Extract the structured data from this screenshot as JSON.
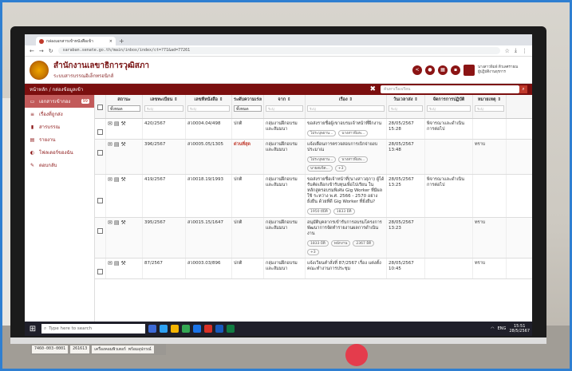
{
  "browser": {
    "tab_title": "กล่องเอกสารเข้าหนังสือเข้า",
    "new_tab": "+",
    "url": "saraban.senate.go.th/main/inbox/index/ct=?71&ad=77261"
  },
  "header": {
    "title": "สำนักงานเลขาธิการวุฒิสภา",
    "subtitle": "ระบบสารบรรณอิเล็กทรอนิกส์",
    "user_name": "นางสาวพิมพ์ ดิวเลศรายณ",
    "user_role": "ผู้ปฏิบัติงานธุรการ"
  },
  "breadcrumb": "หน้าหลัก / กล่องข้อมูลเข้า",
  "search_placeholder": "ค้นหาเรื่องเรียน",
  "sidebar": {
    "items": [
      {
        "label": "เอกสารเข้ากอง",
        "badge": "99",
        "icon": "inbox-icon",
        "glyph": "▭"
      },
      {
        "label": "เรื่องที่ถูกส่ง",
        "badge": "",
        "icon": "filter-icon",
        "glyph": "≡"
      },
      {
        "label": "สารบรรณ",
        "badge": "",
        "icon": "folder-icon",
        "glyph": "▮"
      },
      {
        "label": "รายงาน",
        "badge": "",
        "icon": "report-icon",
        "glyph": "▤"
      },
      {
        "label": "โฟลเดอร์ของฉัน",
        "badge": "",
        "icon": "folder-open-icon",
        "glyph": "◐"
      },
      {
        "label": "ตอบกลับ",
        "badge": "",
        "icon": "edit-icon",
        "glyph": "✎"
      }
    ]
  },
  "table": {
    "columns": [
      {
        "label": "สถานะ",
        "filter": "ทั้งหมด",
        "type": "select"
      },
      {
        "label": "เลขทะเบียน ⇕",
        "filter": "ระบุ",
        "type": "input"
      },
      {
        "label": "เลขที่หนังสือ ⇕",
        "filter": "ระบุ",
        "type": "input"
      },
      {
        "label": "ระดับความเร่งด่วน",
        "filter": "ทั้งหมด",
        "type": "select"
      },
      {
        "label": "จาก ⇕",
        "filter": "ระบุ",
        "type": "input"
      },
      {
        "label": "เรื่อง ⇕",
        "filter": "ระบุ",
        "type": "input"
      },
      {
        "label": "วันเวลาส่ง ⇕",
        "filter": "ระบุ",
        "type": "input"
      },
      {
        "label": "จัดการการปฏิบัติ",
        "filter": "ระบุ",
        "type": "input"
      },
      {
        "label": "หมายเหตุ ⇕",
        "filter": "ระบุ",
        "type": "input"
      }
    ],
    "rows": [
      {
        "reg": "420/2567",
        "doc": "สว0004.04/498",
        "urgency": "ปกติ",
        "urgent": false,
        "from": "กลุ่มงานฝึกอบรม และสัมมนา",
        "subject": "ขอส่งรายชื่อผู้เขาอบรมเจ้าหน้าที่ฝึกงาน",
        "date": "28/05/2567 15:28",
        "action": "พิจารณาและดำเนินการต่อไป",
        "note": "",
        "chips": [
          "ไม่ระบุพยาน...",
          "นางสาวพิมพ..."
        ]
      },
      {
        "reg": "396/2567",
        "doc": "สว0005.05/1305",
        "urgency": "ด่วนที่สุด",
        "urgent": true,
        "from": "กลุ่มงานฝึกอบรม และสัมมนา",
        "subject": "แจ้งเตือนการตรวจสอบการเบิกจ่ายงบประมาณ",
        "date": "28/05/2567 13:48",
        "action": "",
        "note": "ทราบ",
        "chips": [
          "ไม่ระบุพยาน...",
          "นางสาวพิมพ...",
          "นายสมจิต...",
          "+3"
        ]
      },
      {
        "reg": "419/2567",
        "doc": "สว0018.19/1993",
        "urgency": "ปกติ",
        "urgent": false,
        "from": "กลุ่มงานฝึกอบรม และสัมมนา",
        "subject": "ขอส่งรายชื่อเจ้าหน้าที่(นางสาวสุภา) ผู้ได้รับคัดเลือกเข้ารับทุนเพื่อไปเรียน ในหลักสูตรอบรมพิเศษ Gig Worker ที่มีผลใช้ ระหว่าง พ.ศ. 2566 - 2570 อย่างยั่งยืน ด้วยที่ดี Gig Worker ที่ยั่งยืน?",
        "date": "28/05/2567 13:25",
        "action": "พิจารณาและดำเนินการต่อไป",
        "note": "",
        "chips": [
          "1950 มีมิติ",
          "1833 มิติ"
        ]
      },
      {
        "reg": "395/2567",
        "doc": "สว0015.15/1647",
        "urgency": "ปกติ",
        "urgent": false,
        "from": "กลุ่มงานฝึกอบรม และสัมมนา",
        "subject": "อนุมัติบุคลากรเข้ารับการอบรมโครงการพัฒนาการจัดทำรายงานผลการดำเนินงาน",
        "date": "28/05/2567 13:23",
        "action": "",
        "note": "ทราบ",
        "chips": [
          "1833 มิติ",
          "พนักงาน",
          "2367 มิติ",
          "+3"
        ]
      },
      {
        "reg": "87/2567",
        "doc": "สว0003.03/896",
        "urgency": "ปกติ",
        "urgent": false,
        "from": "กลุ่มงานฝึกอบรม และสัมมนา",
        "subject": "แจ้งเวียนคำสั่งที่ 87/2567 เรื่อง แต่งตั้งคณะทำงานการประชุม",
        "date": "28/05/2567 10:45",
        "action": "",
        "note": "ทราบ",
        "chips": []
      }
    ]
  },
  "taskbar": {
    "search_placeholder": "Type here to search",
    "language": "ENG",
    "time": "15:51",
    "date": "28/5/2567"
  },
  "tape_labels": [
    "7460-003-0001",
    "261613",
    "เครื่องคอมพิวเตอร์ พร้อมอุปกรณ์"
  ],
  "colors": {
    "brand": "#7b0f0f",
    "sidebar_active": "#c25a5a",
    "urgent": "#c0392b"
  }
}
